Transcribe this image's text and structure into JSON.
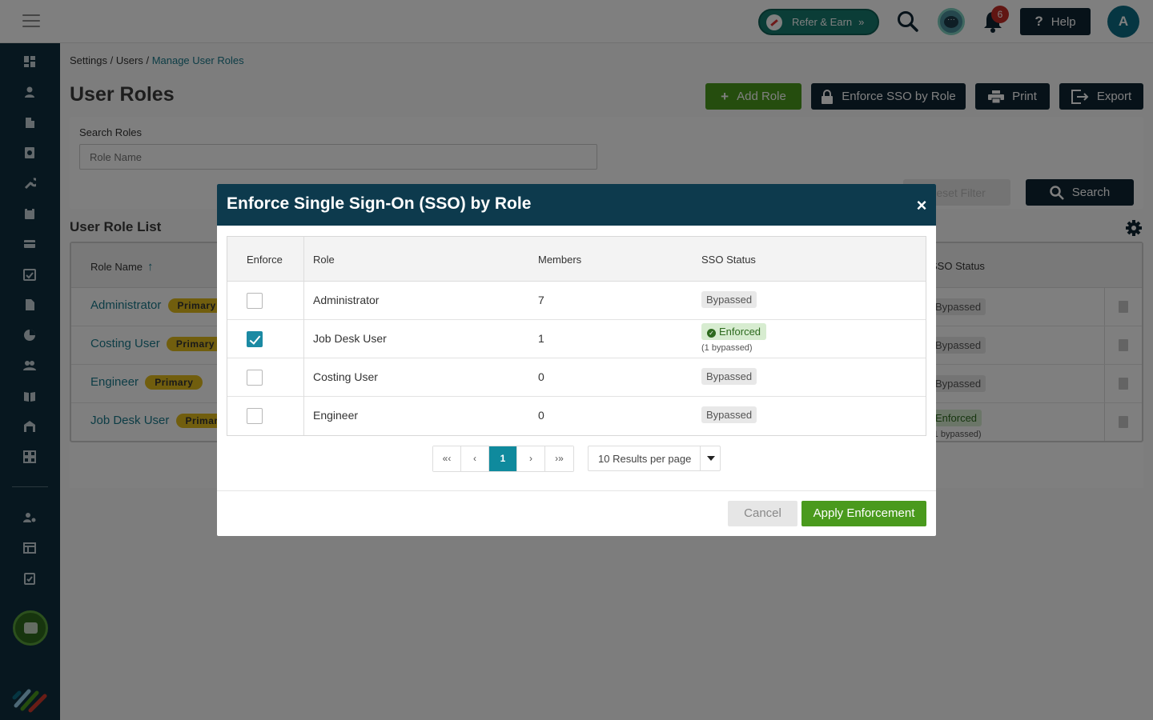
{
  "topbar": {
    "refer_label": "Refer & Earn",
    "notification_count": "6",
    "help_label": "Help",
    "avatar_initial": "A"
  },
  "breadcrumb": {
    "items": [
      "Settings",
      "Users",
      "Manage User Roles"
    ],
    "separator": "/"
  },
  "page": {
    "title": "User Roles",
    "add_role_label": "Add Role",
    "enforce_sso_label": "Enforce SSO by Role",
    "print_label": "Print",
    "export_label": "Export"
  },
  "filter": {
    "search_label": "Search Roles",
    "search_placeholder": "Role Name",
    "reset_label": "Reset Filter",
    "search_button_label": "Search"
  },
  "role_list": {
    "title": "User Role List",
    "col_role_name": "Role Name",
    "col_sso_status": "SSO Status",
    "rows": [
      {
        "name": "Administrator",
        "badge": "Primary",
        "status": "Bypassed",
        "sub": ""
      },
      {
        "name": "Costing User",
        "badge": "Primary",
        "status": "Bypassed",
        "sub": ""
      },
      {
        "name": "Engineer",
        "badge": "Primary",
        "status": "Bypassed",
        "sub": ""
      },
      {
        "name": "Job Desk User",
        "badge": "Primary",
        "status": "Enforced",
        "sub": "(1 bypassed)"
      }
    ]
  },
  "modal": {
    "title": "Enforce Single Sign-On (SSO) by Role",
    "close_symbol": "×",
    "columns": [
      "Enforce",
      "Role",
      "Members",
      "SSO Status"
    ],
    "rows": [
      {
        "enforce": false,
        "role": "Administrator",
        "members": "7",
        "status": "Bypassed",
        "sub": ""
      },
      {
        "enforce": true,
        "role": "Job Desk User",
        "members": "1",
        "status": "Enforced",
        "sub": "(1 bypassed)"
      },
      {
        "enforce": false,
        "role": "Costing User",
        "members": "0",
        "status": "Bypassed",
        "sub": ""
      },
      {
        "enforce": false,
        "role": "Engineer",
        "members": "0",
        "status": "Bypassed",
        "sub": ""
      }
    ],
    "pager": {
      "first": "«‹",
      "prev": "‹",
      "current": "1",
      "next": "›",
      "last": "›»"
    },
    "per_page": "10 Results per page",
    "cancel_label": "Cancel",
    "apply_label": "Apply Enforcement"
  },
  "colors": {
    "sidebar": "#0e2e3f",
    "modal_header": "#0d3a4d",
    "primary_green": "#4a9a1d",
    "dark_button": "#0e2433",
    "teal_accent": "#1b7a8c",
    "badge_yellow": "#e2bd1c"
  },
  "icons": {
    "sidebar": [
      "dashboard-icon",
      "user-icon",
      "building-icon",
      "document-search-icon",
      "wrench-icon",
      "clipboard-icon",
      "card-icon",
      "calendar-check-icon",
      "file-icon",
      "pie-chart-icon",
      "users-icon",
      "book-icon",
      "warehouse-icon",
      "apps-icon",
      "user-settings-icon",
      "table-icon",
      "clipboard-check-icon"
    ]
  }
}
